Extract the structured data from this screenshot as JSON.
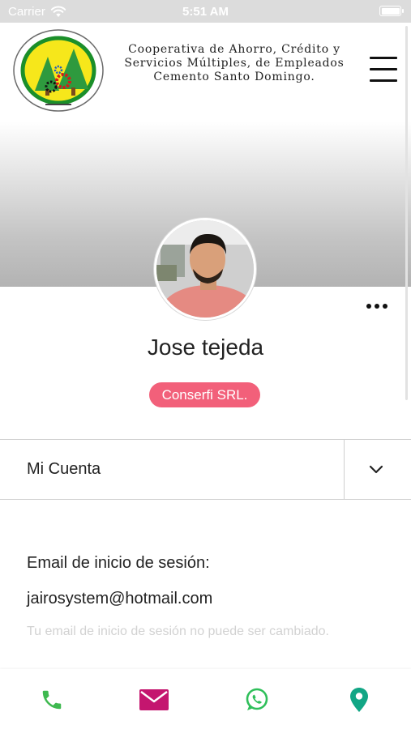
{
  "status_bar": {
    "carrier": "Carrier",
    "time": "5:51 AM",
    "battery_level_percent": 100,
    "wifi_icon": "wifi-icon"
  },
  "header": {
    "org_name": "Cooperativa de Ahorro, Crédito y\nServicios Múltiples, de Empleados\nCemento Santo Domingo.",
    "logo_icon": "cooperative-logo",
    "menu_icon": "hamburger-menu-icon"
  },
  "profile": {
    "name": "Jose tejeda",
    "company": "Conserfi SRL.",
    "avatar_icon": "profile-photo",
    "more_icon": "more-options-icon"
  },
  "account_section": {
    "label": "Mi Cuenta",
    "toggle_icon": "chevron-down-icon"
  },
  "login_email": {
    "title": "Email de inicio de sesión:",
    "value": "jairosystem@hotmail.com",
    "note": "Tu email de inicio de sesión no puede ser cambiado."
  },
  "bottom_bar": {
    "tabs": [
      {
        "icon": "phone-icon",
        "color": "#3fb950"
      },
      {
        "icon": "mail-icon",
        "color": "#c4166f"
      },
      {
        "icon": "whatsapp-icon",
        "color": "#2fbf5a"
      },
      {
        "icon": "location-pin-icon",
        "color": "#12a685"
      }
    ]
  },
  "colors": {
    "badge": "#f2607a",
    "status_bar": "#dcdcdc"
  }
}
